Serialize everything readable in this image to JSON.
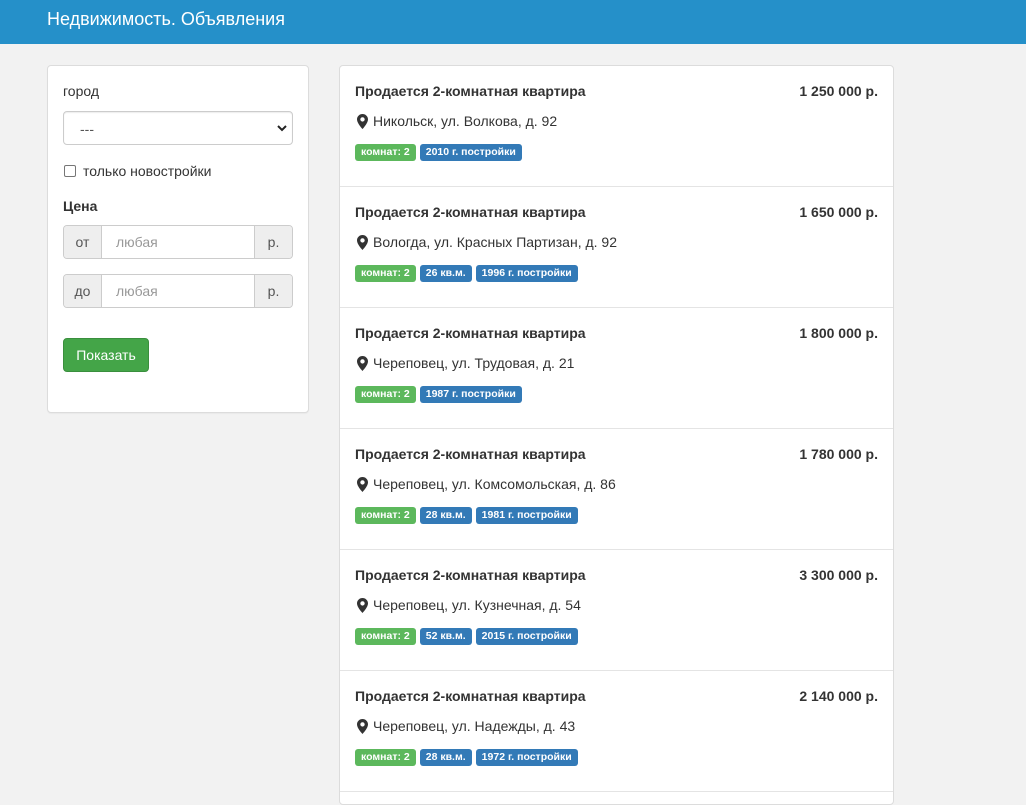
{
  "navbar": {
    "title": "Недвижимость. Объявления"
  },
  "filters": {
    "city_label": "город",
    "city_value": "---",
    "new_only_label": "только новостройки",
    "price_heading": "Цена",
    "price_from": {
      "prefix": "от",
      "placeholder": "любая",
      "suffix": "р."
    },
    "price_to": {
      "prefix": "до",
      "placeholder": "любая",
      "suffix": "р."
    },
    "submit_label": "Показать"
  },
  "colors": {
    "navbar": "#2590c9",
    "rooms_badge": "#5cb85c",
    "info_badge": "#337ab7",
    "button": "#44a548"
  },
  "listings": [
    {
      "title": "Продается 2-комнатная квартира",
      "price": "1 250 000 р.",
      "address": "Никольск, ул. Волкова, д. 92",
      "rooms": "комнат: 2",
      "info": [
        "2010 г. постройки"
      ]
    },
    {
      "title": "Продается 2-комнатная квартира",
      "price": "1 650 000 р.",
      "address": "Вологда, ул. Красных Партизан, д. 92",
      "rooms": "комнат: 2",
      "info": [
        "26 кв.м.",
        "1996 г. постройки"
      ]
    },
    {
      "title": "Продается 2-комнатная квартира",
      "price": "1 800 000 р.",
      "address": "Череповец, ул. Трудовая, д. 21",
      "rooms": "комнат: 2",
      "info": [
        "1987 г. постройки"
      ]
    },
    {
      "title": "Продается 2-комнатная квартира",
      "price": "1 780 000 р.",
      "address": "Череповец, ул. Комсомольская, д. 86",
      "rooms": "комнат: 2",
      "info": [
        "28 кв.м.",
        "1981 г. постройки"
      ]
    },
    {
      "title": "Продается 2-комнатная квартира",
      "price": "3 300 000 р.",
      "address": "Череповец, ул. Кузнечная, д. 54",
      "rooms": "комнат: 2",
      "info": [
        "52 кв.м.",
        "2015 г. постройки"
      ]
    },
    {
      "title": "Продается 2-комнатная квартира",
      "price": "2 140 000 р.",
      "address": "Череповец, ул. Надежды, д. 43",
      "rooms": "комнат: 2",
      "info": [
        "28 кв.м.",
        "1972 г. постройки"
      ]
    }
  ]
}
